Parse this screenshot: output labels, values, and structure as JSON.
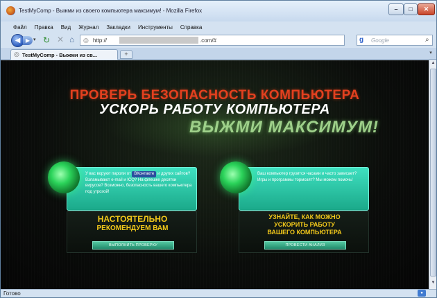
{
  "window": {
    "title": "TestMyComp - Выжми из своего компьютера максимум! - Mozilla Firefox",
    "controls": {
      "minimize_icon": "minimize-icon",
      "maximize_icon": "maximize-icon",
      "close_icon": "close-icon"
    }
  },
  "menu": {
    "items": [
      "Файл",
      "Правка",
      "Вид",
      "Журнал",
      "Закладки",
      "Инструменты",
      "Справка"
    ]
  },
  "nav": {
    "back_icon": "back-arrow-icon",
    "forward_icon": "forward-arrow-icon",
    "reload_icon": "reload-icon",
    "stop_icon": "stop-icon",
    "home_icon": "home-icon",
    "url_prefix": "http://",
    "url_suffix": ".com/#",
    "search_engine": "g",
    "search_placeholder": "Google"
  },
  "tabs": [
    {
      "label": "TestMyComp - Выжми из св..."
    }
  ],
  "page": {
    "headline_red": "ПРОВЕРЬ БЕЗОПАСНОСТЬ КОМПЬЮТЕРА",
    "headline_white": "УСКОРЬ РАБОТУ КОМПЬЮТЕРА",
    "headline_green": "ВЫЖМИ МАКСИМУМ!",
    "left_card": {
      "text_before": "У вас воруют пароли от",
      "badge": "ВКонтакте",
      "text_after": "и других сайтов? Взламывают e-mail и ICQ? На флешке десятки вирусов? Возможно, безопасность вашего компьютера под угрозой!",
      "headline_1": "НАСТОЯТЕЛЬНО",
      "headline_2": "РЕКОМЕНДУЕМ ВАМ",
      "button": "ВЫПОЛНИТЬ ПРОВЕРКУ"
    },
    "right_card": {
      "text": "Ваш компьютер грузится часами и часто зависает? Игры и программы тормозят? Мы можем помочь!",
      "headline_1": "УЗНАЙТЕ, КАК МОЖНО",
      "headline_2": "УСКОРИТЬ РАБОТУ",
      "headline_3": "ВАШЕГО КОМПЬЮТЕРА",
      "button": "ПРОВЕСТИ АНАЛИЗ"
    }
  },
  "status": {
    "text": "Готово"
  },
  "colors": {
    "accent_red": "#e3401f",
    "accent_green": "#9ed08a",
    "card_teal": "#2bc4a4",
    "headline_yellow": "#f2c81a"
  }
}
